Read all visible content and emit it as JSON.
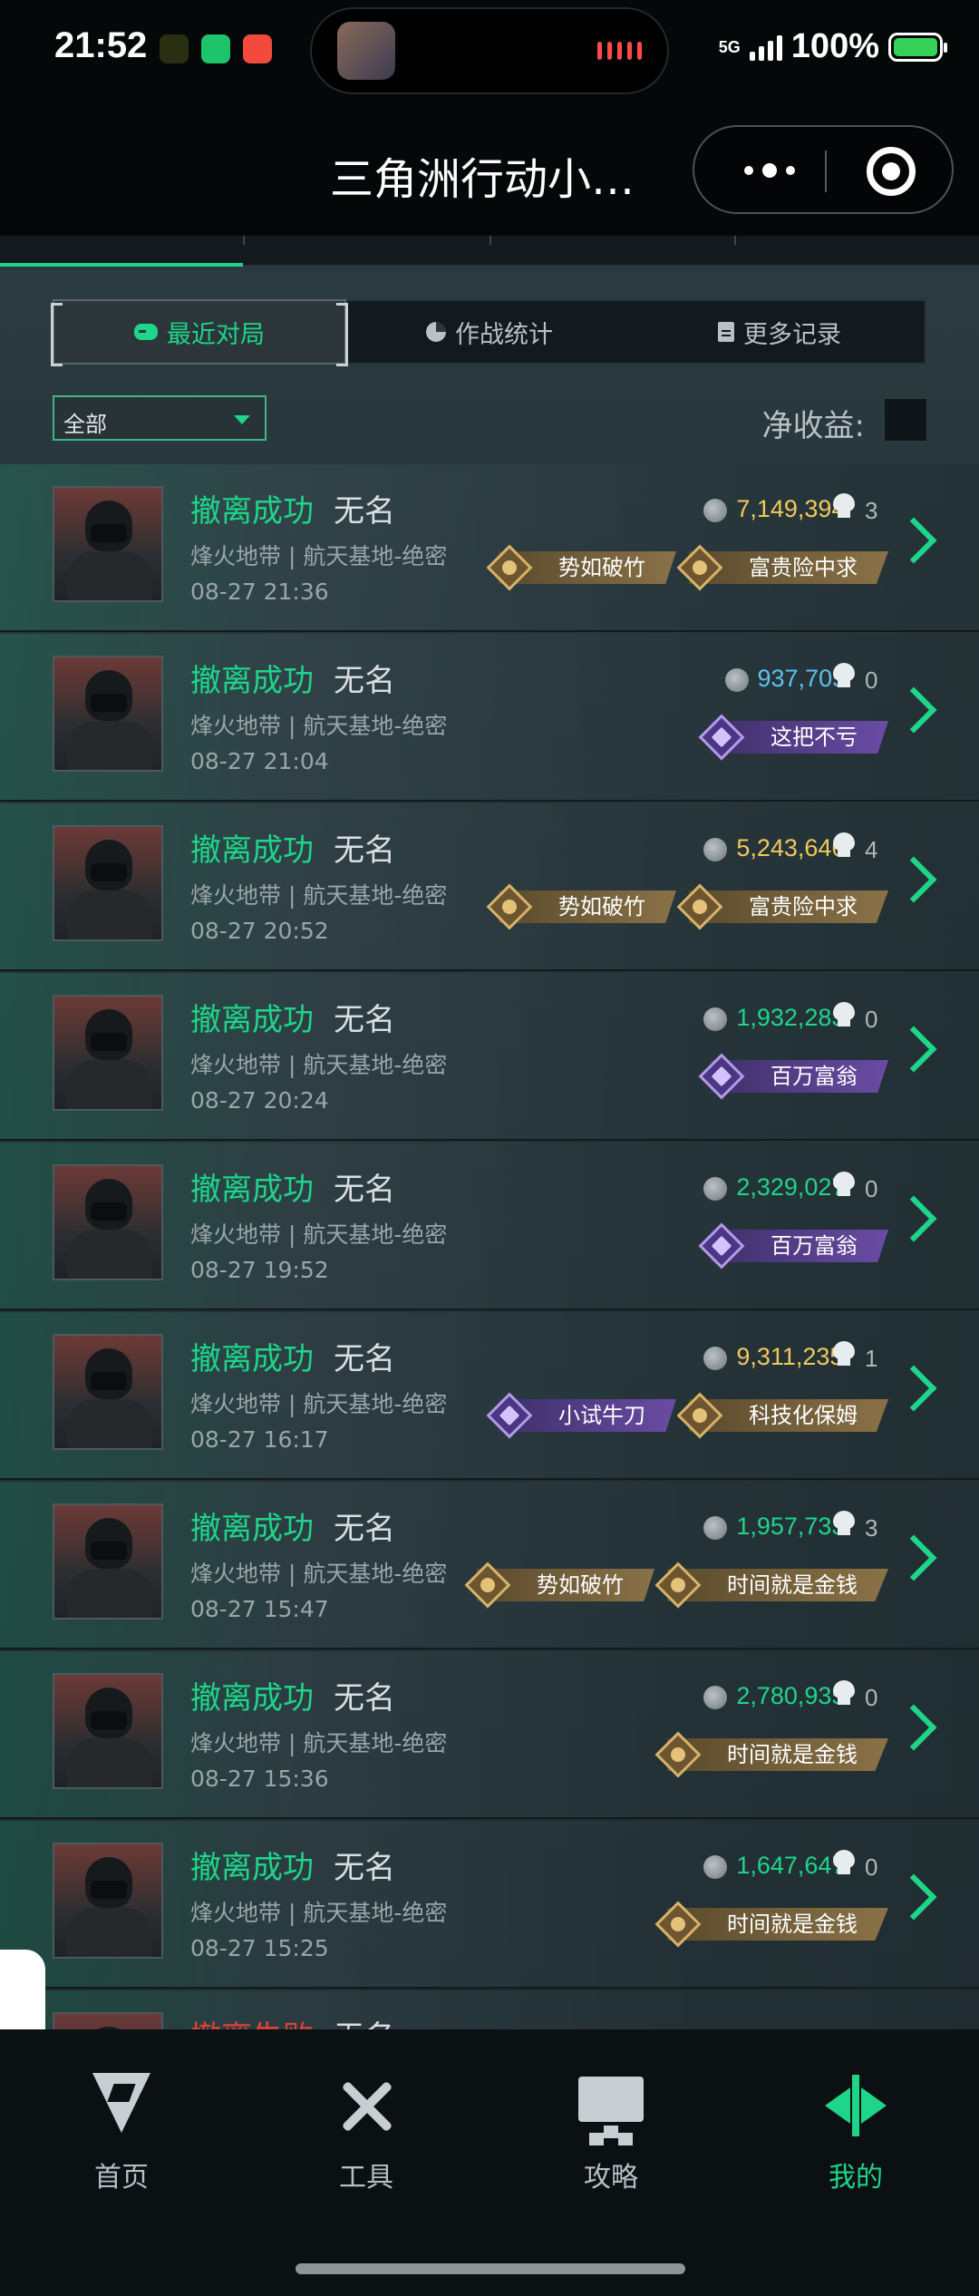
{
  "status_bar": {
    "time": "21:52",
    "network": "5G",
    "battery": "100%"
  },
  "nav": {
    "title": "三角洲行动小…"
  },
  "subtabs": [
    {
      "label": "最近对局",
      "active": true,
      "icon": "gamepad-icon"
    },
    {
      "label": "作战统计",
      "active": false,
      "icon": "pie-chart-icon"
    },
    {
      "label": "更多记录",
      "active": false,
      "icon": "document-icon"
    }
  ],
  "filter": {
    "selected": "全部"
  },
  "net_income_label": "净收益:",
  "rows": [
    {
      "status": "撤离成功",
      "name": "无名",
      "map": "烽火地带 | 航天基地-绝密",
      "time": "08-27 21:36",
      "value": "7,149,394",
      "value_color": "#f0c95a",
      "kills": "3",
      "badges": [
        {
          "label": "势如破竹",
          "kind": "gold"
        },
        {
          "label": "富贵险中求",
          "kind": "gold"
        }
      ]
    },
    {
      "status": "撤离成功",
      "name": "无名",
      "map": "烽火地带 | 航天基地-绝密",
      "time": "08-27 21:04",
      "value": "937,705",
      "value_color": "#5fc0f0",
      "kills": "0",
      "badges": [
        {
          "label": "这把不亏",
          "kind": "purple"
        }
      ]
    },
    {
      "status": "撤离成功",
      "name": "无名",
      "map": "烽火地带 | 航天基地-绝密",
      "time": "08-27 20:52",
      "value": "5,243,646",
      "value_color": "#f0c95a",
      "kills": "4",
      "badges": [
        {
          "label": "势如破竹",
          "kind": "gold"
        },
        {
          "label": "富贵险中求",
          "kind": "gold"
        }
      ]
    },
    {
      "status": "撤离成功",
      "name": "无名",
      "map": "烽火地带 | 航天基地-绝密",
      "time": "08-27 20:24",
      "value": "1,932,283",
      "value_color": "#1ed58a",
      "kills": "0",
      "badges": [
        {
          "label": "百万富翁",
          "kind": "purple"
        }
      ]
    },
    {
      "status": "撤离成功",
      "name": "无名",
      "map": "烽火地带 | 航天基地-绝密",
      "time": "08-27 19:52",
      "value": "2,329,027",
      "value_color": "#1ed58a",
      "kills": "0",
      "badges": [
        {
          "label": "百万富翁",
          "kind": "purple"
        }
      ]
    },
    {
      "status": "撤离成功",
      "name": "无名",
      "map": "烽火地带 | 航天基地-绝密",
      "time": "08-27 16:17",
      "value": "9,311,235",
      "value_color": "#f0c95a",
      "kills": "1",
      "badges": [
        {
          "label": "小试牛刀",
          "kind": "purple"
        },
        {
          "label": "科技化保姆",
          "kind": "gold"
        }
      ]
    },
    {
      "status": "撤离成功",
      "name": "无名",
      "map": "烽火地带 | 航天基地-绝密",
      "time": "08-27 15:47",
      "value": "1,957,733",
      "value_color": "#1ed58a",
      "kills": "3",
      "badges": [
        {
          "label": "势如破竹",
          "kind": "gold"
        },
        {
          "label": "时间就是金钱",
          "kind": "gold"
        }
      ]
    },
    {
      "status": "撤离成功",
      "name": "无名",
      "map": "烽火地带 | 航天基地-绝密",
      "time": "08-27 15:36",
      "value": "2,780,935",
      "value_color": "#1ed58a",
      "kills": "0",
      "badges": [
        {
          "label": "时间就是金钱",
          "kind": "gold"
        }
      ]
    },
    {
      "status": "撤离成功",
      "name": "无名",
      "map": "烽火地带 | 航天基地-绝密",
      "time": "08-27 15:25",
      "value": "1,647,647",
      "value_color": "#1ed58a",
      "kills": "0",
      "badges": [
        {
          "label": "时间就是金钱",
          "kind": "gold"
        }
      ]
    },
    {
      "status": "撤离失败",
      "name": "无名",
      "map": "",
      "time": "",
      "value": "",
      "value_color": "#1ed58a",
      "kills": "",
      "badges": [],
      "failed": true
    }
  ],
  "tabbar": [
    {
      "label": "首页",
      "icon": "home-logo-icon",
      "active": false
    },
    {
      "label": "工具",
      "icon": "tools-icon",
      "active": false
    },
    {
      "label": "攻略",
      "icon": "monitor-icon",
      "active": false
    },
    {
      "label": "我的",
      "icon": "profile-logo-icon",
      "active": true
    }
  ]
}
